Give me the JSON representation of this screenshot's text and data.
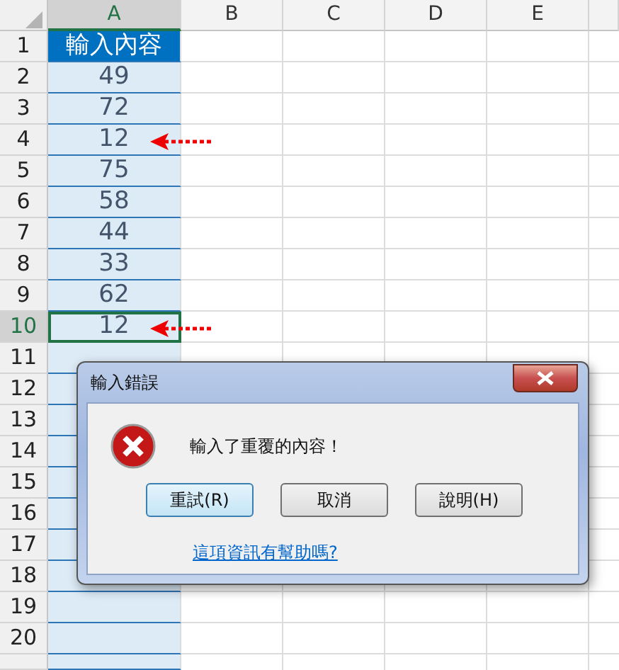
{
  "columns": [
    {
      "label": "A",
      "selected": true
    },
    {
      "label": "B",
      "selected": false
    },
    {
      "label": "C",
      "selected": false
    },
    {
      "label": "D",
      "selected": false
    },
    {
      "label": "E",
      "selected": false
    }
  ],
  "rows": [
    {
      "number": "1",
      "kind": "header",
      "cell_a": "輸入內容",
      "selected": false,
      "marked": false
    },
    {
      "number": "2",
      "kind": "data",
      "cell_a": "49",
      "selected": false,
      "marked": false
    },
    {
      "number": "3",
      "kind": "data",
      "cell_a": "72",
      "selected": false,
      "marked": false
    },
    {
      "number": "4",
      "kind": "data",
      "cell_a": "12",
      "selected": false,
      "marked": true
    },
    {
      "number": "5",
      "kind": "data",
      "cell_a": "75",
      "selected": false,
      "marked": false
    },
    {
      "number": "6",
      "kind": "data",
      "cell_a": "58",
      "selected": false,
      "marked": false
    },
    {
      "number": "7",
      "kind": "data",
      "cell_a": "44",
      "selected": false,
      "marked": false
    },
    {
      "number": "8",
      "kind": "data",
      "cell_a": "33",
      "selected": false,
      "marked": false
    },
    {
      "number": "9",
      "kind": "data",
      "cell_a": "62",
      "selected": false,
      "marked": false
    },
    {
      "number": "10",
      "kind": "data",
      "cell_a": "12",
      "selected": true,
      "marked": true
    },
    {
      "number": "11",
      "kind": "empty",
      "selected": false,
      "marked": false
    },
    {
      "number": "12",
      "kind": "empty",
      "selected": false,
      "marked": false
    },
    {
      "number": "13",
      "kind": "empty",
      "selected": false,
      "marked": false
    },
    {
      "number": "14",
      "kind": "empty",
      "selected": false,
      "marked": false
    },
    {
      "number": "15",
      "kind": "empty",
      "selected": false,
      "marked": false
    },
    {
      "number": "16",
      "kind": "empty",
      "selected": false,
      "marked": false
    },
    {
      "number": "17",
      "kind": "empty",
      "selected": false,
      "marked": false
    },
    {
      "number": "18",
      "kind": "empty",
      "selected": false,
      "marked": false
    },
    {
      "number": "19",
      "kind": "empty",
      "selected": false,
      "marked": false
    },
    {
      "number": "20",
      "kind": "empty",
      "selected": false,
      "marked": false
    }
  ],
  "dialog": {
    "title": "輸入錯誤",
    "message": "輸入了重覆的內容！",
    "buttons": [
      {
        "label": "重試(R)",
        "selected": true
      },
      {
        "label": "取消",
        "selected": false
      },
      {
        "label": "說明(H)",
        "selected": false
      }
    ],
    "link": "這項資訊有幫助嗎?"
  }
}
